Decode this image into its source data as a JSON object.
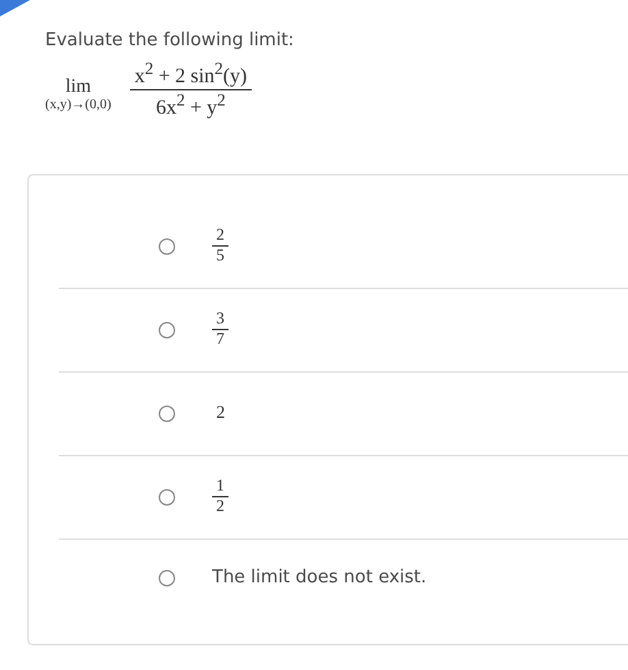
{
  "question": {
    "prompt": "Evaluate the following limit:",
    "limit": {
      "operator": "lim",
      "subscript": "(x,y)→(0,0)",
      "numerator": "x$^{2}$ + 2 sin$^{2}$(y)",
      "denominator": "6x$^{2}$ + y$^{2}$"
    }
  },
  "options": [
    {
      "kind": "fraction",
      "numerator": "2",
      "denominator": "5",
      "selected": false
    },
    {
      "kind": "fraction",
      "numerator": "3",
      "denominator": "7",
      "selected": false
    },
    {
      "kind": "number",
      "text": "2",
      "selected": false
    },
    {
      "kind": "fraction",
      "numerator": "1",
      "denominator": "2",
      "selected": false
    },
    {
      "kind": "text",
      "text": "The limit does not exist.",
      "selected": false
    }
  ]
}
